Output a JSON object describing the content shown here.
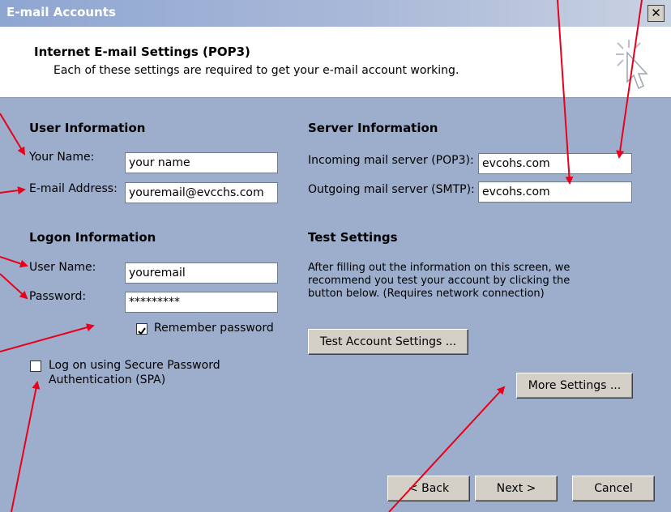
{
  "window": {
    "title": "E-mail Accounts",
    "close_glyph": "✕"
  },
  "header": {
    "title": "Internet E-mail Settings (POP3)",
    "subtitle": "Each of these settings are required to get your e-mail account working."
  },
  "user_info": {
    "heading": "User Information",
    "name_label": "Your Name:",
    "name_value": "your name",
    "email_label": "E-mail Address:",
    "email_value": "youremail@evcchs.com"
  },
  "logon_info": {
    "heading": "Logon Information",
    "username_label": "User Name:",
    "username_value": "youremail",
    "password_label": "Password:",
    "password_value": "*********",
    "remember_label": "Remember password",
    "remember_checked": true,
    "spa_label_line1": "Log on using Secure Password",
    "spa_label_line2": "Authentication (SPA)",
    "spa_checked": false
  },
  "server_info": {
    "heading": "Server Information",
    "incoming_label": "Incoming mail server (POP3):",
    "incoming_value": "evcohs.com",
    "outgoing_label": "Outgoing mail server (SMTP):",
    "outgoing_value": "evcohs.com"
  },
  "test_settings": {
    "heading": "Test Settings",
    "description": "After filling out the information on this screen, we recommend you test your account by clicking the button below. (Requires network connection)",
    "test_button": "Test Account Settings ...",
    "more_button": "More Settings ..."
  },
  "footer": {
    "back_button": "< Back",
    "next_button": "Next >",
    "cancel_button": "Cancel"
  },
  "colors": {
    "dialog_bg": "#9caecb",
    "annotation_arrow": "#e8001c"
  },
  "icons": [
    "close-icon",
    "cursor-sparkle-icon",
    "checkmark-icon",
    "annotation-arrow"
  ]
}
